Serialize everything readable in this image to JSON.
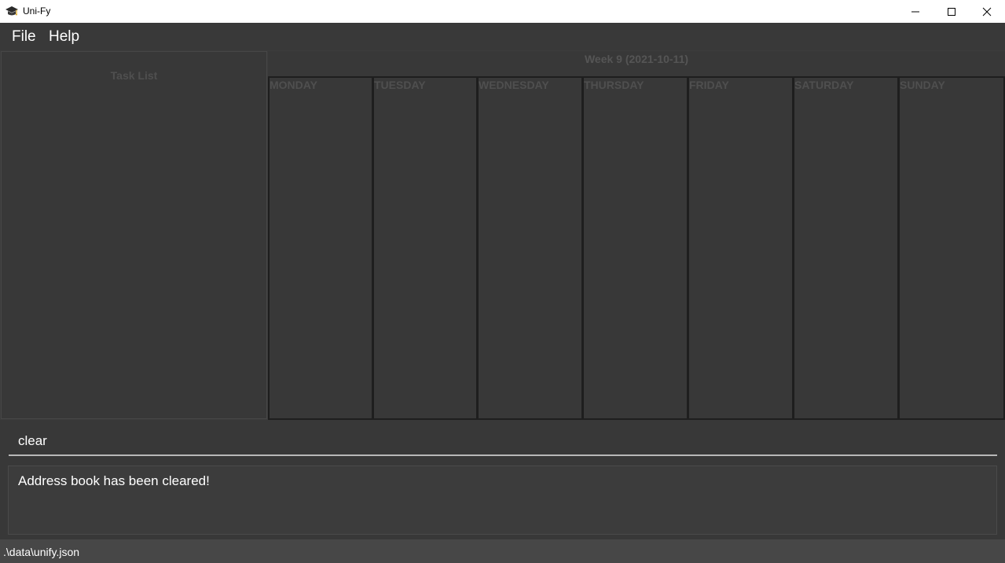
{
  "window": {
    "title": "Uni-Fy",
    "icon": "graduation-cap-icon"
  },
  "menu": {
    "file": "File",
    "help": "Help"
  },
  "task_list": {
    "title": "Task List"
  },
  "calendar": {
    "week_title": "Week 9 (2021-10-11)",
    "days": [
      "MONDAY",
      "TUESDAY",
      "WEDNESDAY",
      "THURSDAY",
      "FRIDAY",
      "SATURDAY",
      "SUNDAY"
    ]
  },
  "command": {
    "value": "clear"
  },
  "result": {
    "message": "Address book has been cleared!"
  },
  "status": {
    "file_path": ".\\data\\unify.json"
  },
  "colors": {
    "background": "#3c3c3c",
    "panel": "#383838",
    "column_border": "#1e1e1e",
    "text": "#ffffff",
    "muted_text": "#4f4f4f"
  }
}
